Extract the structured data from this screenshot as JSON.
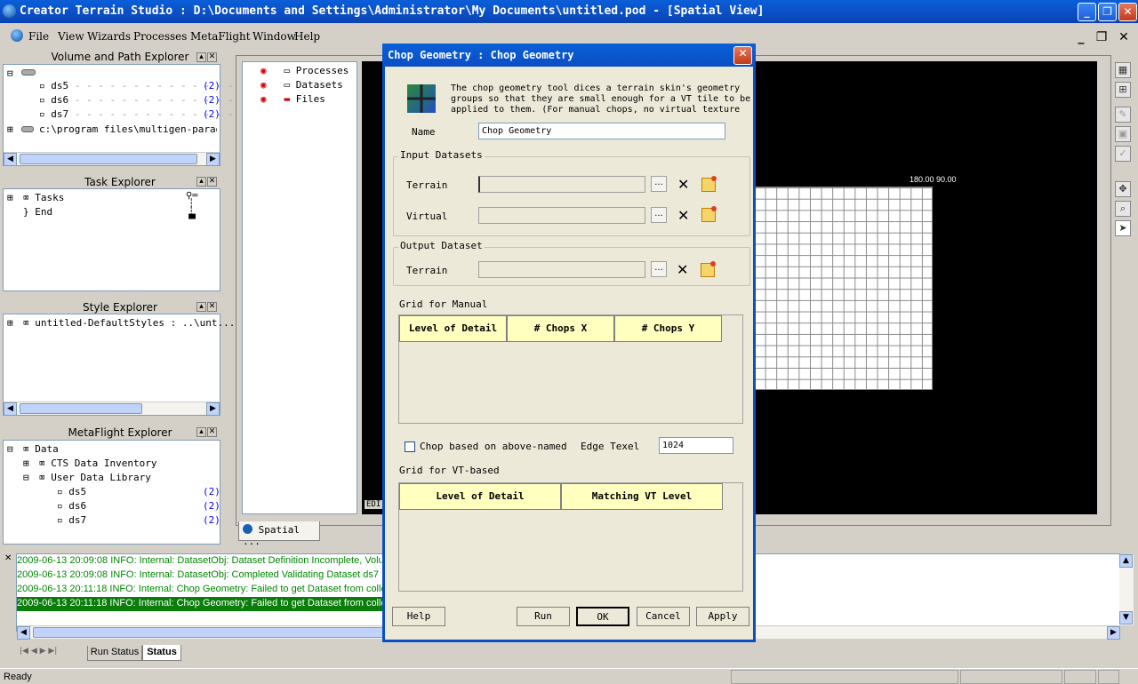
{
  "window": {
    "title": "Creator Terrain Studio : D:\\Documents and Settings\\Administrator\\My Documents\\untitled.pod - [Spatial View]"
  },
  "menu": [
    "File",
    "View",
    "Wizards",
    "Processes",
    "MetaFlight",
    "Window",
    "Help"
  ],
  "volume_explorer": {
    "title": "Volume and Path Explorer",
    "items": [
      {
        "name": "ds5",
        "count": "(2)"
      },
      {
        "name": "ds6",
        "count": "(2)"
      },
      {
        "name": "ds7",
        "count": "(2)"
      }
    ],
    "path": "c:\\program files\\multigen-paradigm"
  },
  "task_explorer": {
    "title": "Task Explorer",
    "items": [
      "Tasks",
      "End"
    ]
  },
  "style_explorer": {
    "title": "Style Explorer",
    "item": "untitled-DefaultStyles : ..\\unt..."
  },
  "metaflight_explorer": {
    "title": "MetaFlight Explorer",
    "items": [
      "Data",
      "CTS Data Inventory",
      "User Data Library"
    ],
    "datasets": [
      {
        "name": "ds5",
        "count": "(2)"
      },
      {
        "name": "ds6",
        "count": "(2)"
      },
      {
        "name": "ds7",
        "count": "(2)"
      }
    ]
  },
  "mid_tree": [
    "Processes",
    "Datasets",
    "Files"
  ],
  "view_tab": "Spatial ...",
  "spatial": {
    "coord_label": "180.00 90.00",
    "edit_label": "EDI"
  },
  "dialog": {
    "title": "Chop Geometry : Chop Geometry",
    "description": "The chop geometry tool dices a terrain skin's geometry groups so that they are small enough for a VT tile to be applied to them.  (For manual chops, no virtual texture",
    "name_label": "Name",
    "name_value": "Chop Geometry",
    "input_group": "Input Datasets",
    "terrain_label": "Terrain",
    "virtual_label": "Virtual",
    "output_group": "Output Dataset",
    "output_terrain_label": "Terrain",
    "browse": "...",
    "grid_manual_label": "Grid for Manual",
    "manual_cols": [
      "Level of Detail",
      "# Chops X",
      "# Chops Y"
    ],
    "chop_checkbox": "Chop based on above-named V:",
    "edge_texel_label": "Edge Texel",
    "edge_texel_value": "1024",
    "grid_vt_label": "Grid for VT-based",
    "vt_cols": [
      "Level of Detail",
      "Matching VT Level"
    ],
    "buttons": {
      "help": "Help",
      "run": "Run",
      "ok": "OK",
      "cancel": "Cancel",
      "apply": "Apply"
    }
  },
  "log": {
    "lines": [
      "2009-06-13 20:09:08 INFO: Internal: DatasetObj: Dataset Definition Incomplete, Volume",
      "2009-06-13 20:09:08 INFO: Internal: DatasetObj: Completed Validating Dataset ds7",
      "2009-06-13 20:11:18 INFO: Internal: Chop Geometry: Failed to get Dataset from collec",
      "2009-06-13 20:11:18 INFO: Internal: Chop Geometry: Failed to get Dataset from collec"
    ]
  },
  "bottom_tabs": [
    "Run Status",
    "Status"
  ],
  "status_bar": "Ready"
}
